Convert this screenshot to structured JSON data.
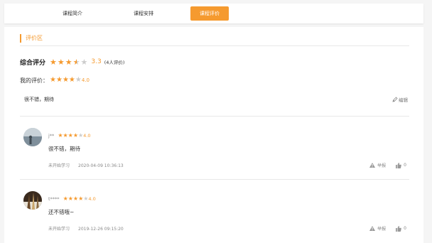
{
  "tabs": [
    {
      "label": "课程简介",
      "active": false
    },
    {
      "label": "课程安排",
      "active": false
    },
    {
      "label": "课程评价",
      "active": true
    }
  ],
  "section_title": "评价区",
  "overall": {
    "label": "综合评分",
    "rating": 3.3,
    "score_text": "3.3",
    "count_text": "(4人评价)"
  },
  "mine": {
    "label": "我的评价：",
    "rating": 4,
    "score_text": "4.0",
    "comment": "很不错，期待",
    "edit_label": "编辑"
  },
  "reviews": [
    {
      "user": "j**",
      "rating": 4,
      "score_text": "4.0",
      "text": "很不错，期待",
      "status": "未开始学习",
      "date": "2020-04-09 10:36:13",
      "report_label": "举报",
      "likes": "0"
    },
    {
      "user": "t****",
      "rating": 4,
      "score_text": "4.0",
      "text": "还不错哦~",
      "status": "未开始学习",
      "date": "2019-12-26 09:15:20",
      "report_label": "举报",
      "likes": "0"
    }
  ],
  "colors": {
    "accent": "#f59a2f",
    "star_off": "#cccccc",
    "background": "#f5f5f5"
  },
  "icons": {
    "star": "star-icon",
    "edit": "pencil-icon",
    "report": "warning-icon",
    "like": "thumbs-up-icon"
  }
}
